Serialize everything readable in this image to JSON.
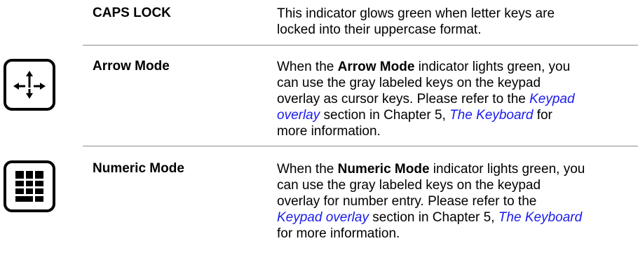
{
  "rows": [
    {
      "term": "CAPS LOCK",
      "desc": "This indicator glows green when letter keys are locked into their uppercase format."
    },
    {
      "icon": "arrow-mode-icon",
      "term": "Arrow Mode",
      "desc_pre": "When the ",
      "desc_bold": "Arrow Mode",
      "desc_mid": " indicator lights green, you can use the gray labeled keys on the keypad overlay as cursor keys. Please refer to the ",
      "link1": "Keypad overlay",
      "desc_mid2": " section in Chapter 5, ",
      "link2": "The Keyboard",
      "desc_post": " for more information."
    },
    {
      "icon": "numeric-mode-icon",
      "term": "Numeric Mode",
      "desc_pre": "When the ",
      "desc_bold": "Numeric Mode",
      "desc_mid": " indicator lights green, you can use the gray labeled keys on the keypad overlay for number entry. Please refer to the ",
      "link1": "Keypad overlay",
      "desc_mid2": " section in Chapter 5, ",
      "link2": "The Keyboard",
      "desc_post": " for more information."
    }
  ],
  "colors": {
    "link": "#1a1aee",
    "rule": "#8c8c8c"
  }
}
